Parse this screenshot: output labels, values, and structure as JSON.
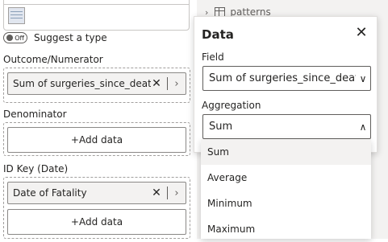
{
  "fields_pane": {
    "suggest_toggle": {
      "state_text": "Off",
      "label": "Suggest a type"
    },
    "outcome": {
      "label": "Outcome/Numerator",
      "field_pill": "Sum of surgeries_since_death"
    },
    "denominator": {
      "label": "Denominator",
      "add_label": "+Add data"
    },
    "id_key": {
      "label": "ID Key (Date)",
      "field_pill": "Date of Fatality",
      "add_label": "+Add data"
    }
  },
  "data_tree": {
    "item_label": "patterns"
  },
  "data_popup": {
    "title": "Data",
    "field_label": "Field",
    "field_value": "Sum of surgeries_since_death",
    "aggregation_label": "Aggregation",
    "aggregation_value": "Sum",
    "aggregation_options": [
      "Sum",
      "Average",
      "Minimum",
      "Maximum"
    ]
  },
  "icons": {
    "close": "close-icon",
    "chevron_down": "chevron-down-icon",
    "chevron_up": "chevron-up-icon",
    "chevron_right": "chevron-right-icon",
    "table": "table-icon",
    "caret_right": "caret-right-icon"
  }
}
